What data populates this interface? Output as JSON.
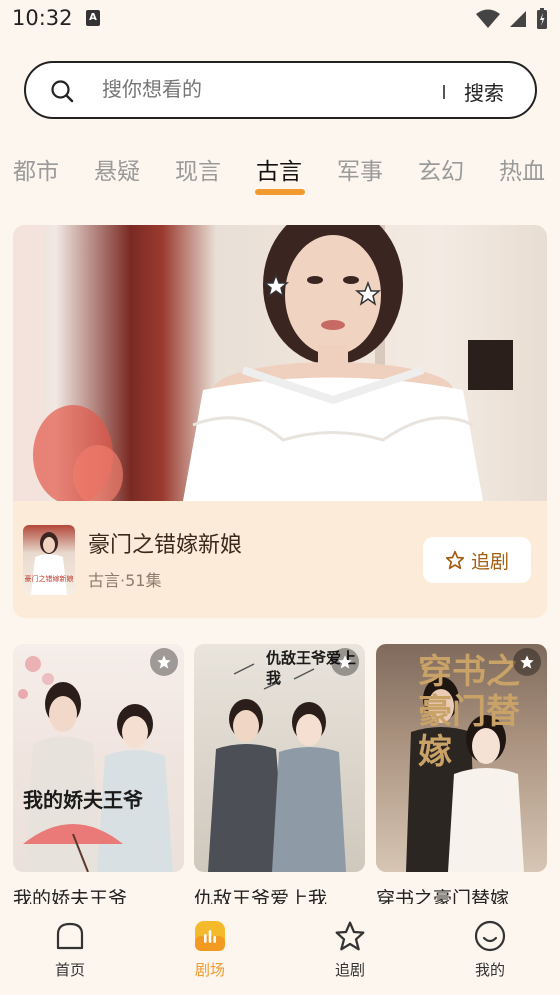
{
  "status_bar": {
    "time": "10:32"
  },
  "search": {
    "placeholder": "搜你想看的",
    "button_label": "搜索"
  },
  "tabs": [
    {
      "label": "都市",
      "active": false
    },
    {
      "label": "悬疑",
      "active": false
    },
    {
      "label": "现言",
      "active": false
    },
    {
      "label": "古言",
      "active": true
    },
    {
      "label": "军事",
      "active": false
    },
    {
      "label": "玄幻",
      "active": false
    },
    {
      "label": "热血",
      "active": false
    }
  ],
  "featured": {
    "title": "豪门之错嫁新娘",
    "meta": "古言·51集",
    "follow_label": "追剧",
    "thumb_text": "豪门之错嫁新娘"
  },
  "dramas": [
    {
      "title": "我的娇夫王爷",
      "poster_caption": "我的娇夫王爷"
    },
    {
      "title": "仇敌王爷爱上我",
      "poster_caption": "仇敌王爷爱上我"
    },
    {
      "title": "穿书之豪门替嫁",
      "poster_caption": "穿书之豪门替嫁"
    }
  ],
  "bottom_nav": [
    {
      "label": "首页",
      "icon": "home-icon",
      "active": false
    },
    {
      "label": "剧场",
      "icon": "theater-icon",
      "active": true
    },
    {
      "label": "追剧",
      "icon": "star-icon",
      "active": false
    },
    {
      "label": "我的",
      "icon": "profile-icon",
      "active": false
    }
  ],
  "colors": {
    "accent": "#f09a2f",
    "background": "#fdf6ee",
    "card": "#fcebd8"
  }
}
